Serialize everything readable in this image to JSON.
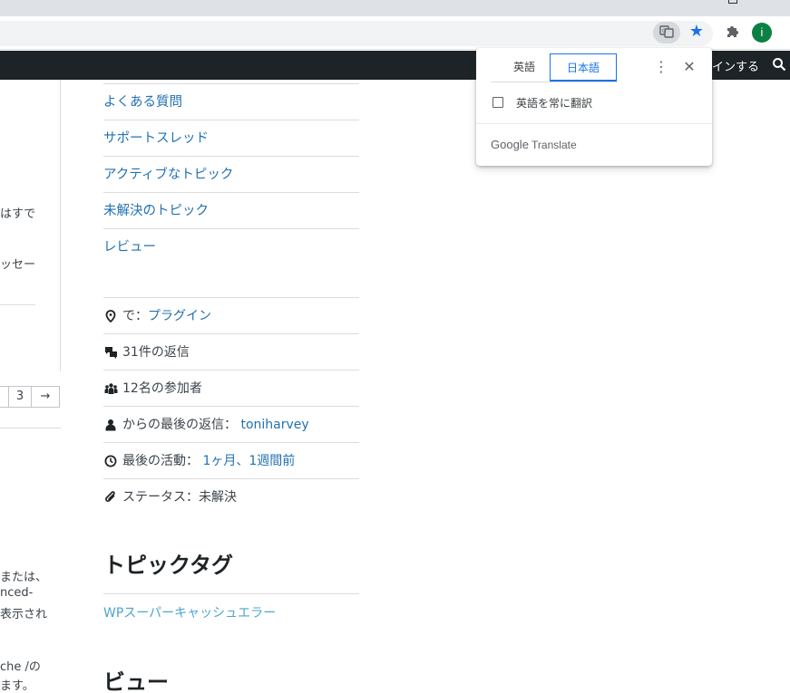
{
  "browser": {
    "profile_initial": "i",
    "star_color": "#1a73e8",
    "profile_color": "#0b8043"
  },
  "site": {
    "signin_label": "インする"
  },
  "left_fragments": {
    "line1": "はすで",
    "line2": "ッセー",
    "page_num": "3",
    "next_arrow": "→",
    "bottom1": "または、",
    "bottom2": "nced-",
    "bottom3": "表示され",
    "bottom4": "che /の",
    "bottom5": "ます。"
  },
  "sidebar": {
    "views": [
      {
        "label": "よくある質問"
      },
      {
        "label": "サポートスレッド"
      },
      {
        "label": "アクティブなトピック"
      },
      {
        "label": "未解決のトピック"
      },
      {
        "label": "レビュー"
      }
    ],
    "meta": {
      "in_prefix": "で：",
      "in_link": "プラグイン",
      "replies": "31件の返信",
      "participants": "12名の参加者",
      "last_reply_prefix": "からの最後の返信：",
      "last_reply_user": "toniharvey",
      "last_activity_prefix": "最後の活動：",
      "last_activity_link": "1ヶ月、1週間前",
      "status": "ステータス：未解決"
    },
    "tags_title": "トピックタグ",
    "tag_link": "WPスーパーキャッシュエラー",
    "views_title": "ビュー"
  },
  "translate_popup": {
    "tab_source": "英語",
    "tab_target": "日本語",
    "always_translate_label": "英語を常に翻訳",
    "brand_google": "Google",
    "brand_translate": "Translate",
    "accent_color": "#1a73e8"
  }
}
